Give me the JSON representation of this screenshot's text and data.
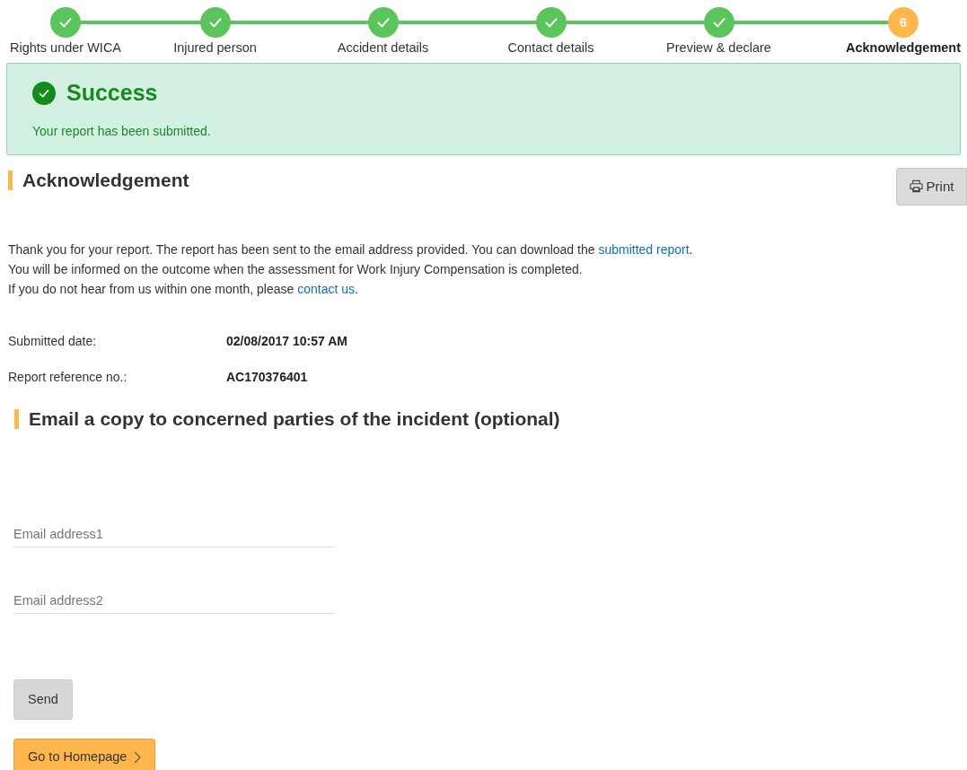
{
  "steps": [
    {
      "label": "Rights under WICA",
      "completed": true,
      "selected": false
    },
    {
      "label": "Injured person",
      "completed": true,
      "selected": false
    },
    {
      "label": "Accident details",
      "completed": true,
      "selected": false
    },
    {
      "label": "Contact details",
      "completed": true,
      "selected": false
    },
    {
      "label": "Preview & declare",
      "completed": true,
      "selected": false
    },
    {
      "label": "Acknowledgement",
      "completed": false,
      "selected": true,
      "number": "6"
    }
  ],
  "alert": {
    "title": "Success",
    "message": "Your report has been submitted."
  },
  "section_title": "Acknowledgement",
  "print_button": "Print",
  "paragraph_lines": [
    {
      "before": "Thank you for your report. The report has been sent to the email address provided. You can download the ",
      "link": "submitted report",
      "after": "."
    },
    {
      "before": "You will be informed on the outcome when the assessment for Work Injury Compensation is completed."
    },
    {
      "before": "If you do not hear from us within one month, please ",
      "link": "contact us",
      "after": "."
    }
  ],
  "details": [
    {
      "label": "Submitted date:",
      "value": "02/08/2017 10:57 AM"
    },
    {
      "label": "Report reference no.:",
      "value": "AC170376401"
    }
  ],
  "email_section_title": "Email a copy to concerned parties of the incident (optional)",
  "email_fields": [
    {
      "placeholder": "Email address1"
    },
    {
      "placeholder": "Email address2"
    }
  ],
  "send_button": "Send",
  "home_button": "Go to Homepage"
}
